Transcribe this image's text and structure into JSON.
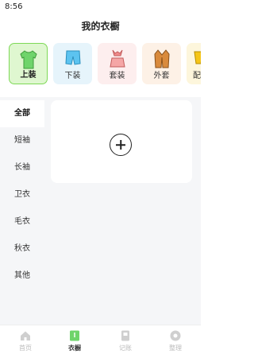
{
  "status_bar": {
    "time": "8:56"
  },
  "header": {
    "title": "我的衣橱"
  },
  "categories": [
    {
      "label": "上装",
      "icon": "tshirt-icon",
      "color": "#6fd46b",
      "active": true
    },
    {
      "label": "下装",
      "icon": "shorts-icon",
      "color": "#5cc3f0",
      "active": false
    },
    {
      "label": "套装",
      "icon": "suit-set-icon",
      "color": "#f08a8a",
      "active": false
    },
    {
      "label": "外套",
      "icon": "coat-icon",
      "color": "#d98a3c",
      "active": false
    },
    {
      "label": "配",
      "icon": "accessory-icon",
      "color": "#f5c518",
      "active": false
    }
  ],
  "sidebar": {
    "items": [
      {
        "label": "全部",
        "active": true
      },
      {
        "label": "短袖",
        "active": false
      },
      {
        "label": "长袖",
        "active": false
      },
      {
        "label": "卫衣",
        "active": false
      },
      {
        "label": "毛衣",
        "active": false
      },
      {
        "label": "秋衣",
        "active": false
      },
      {
        "label": "其他",
        "active": false
      }
    ]
  },
  "main": {
    "add_icon": "plus-icon"
  },
  "tabbar": {
    "items": [
      {
        "label": "首页",
        "icon": "home-icon",
        "active": false
      },
      {
        "label": "衣橱",
        "icon": "wardrobe-icon",
        "active": true
      },
      {
        "label": "记账",
        "icon": "ledger-icon",
        "active": false
      },
      {
        "label": "整理",
        "icon": "organize-icon",
        "active": false
      }
    ]
  },
  "colors": {
    "accent": "#7ed957",
    "accent_bg": "#dff7d0",
    "panel_bg": "#f5f6f8"
  }
}
